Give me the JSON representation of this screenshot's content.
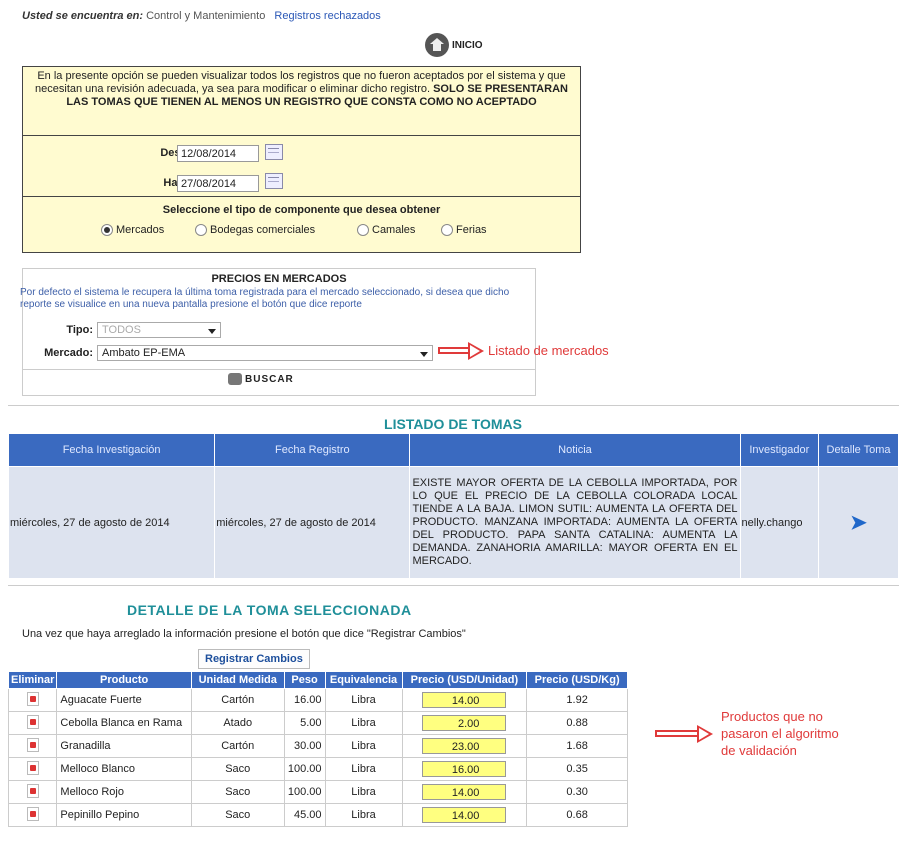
{
  "breadcrumb": {
    "label": "Usted se encuentra en:",
    "path": "Control y Mantenimiento",
    "current": "Registros rechazados"
  },
  "inicio_label": "INICIO",
  "filter": {
    "description_normal": "En la presente opción se pueden visualizar todos los registros que no fueron aceptados por el sistema y que necesitan una revisión adecuada, ya sea para modificar o eliminar dicho registro.",
    "description_bold": "SOLO SE PRESENTARAN LAS TOMAS QUE TIENEN AL MENOS UN REGISTRO QUE CONSTA COMO NO ACEPTADO",
    "desde_label": "Desde:",
    "desde_value": "12/08/2014",
    "hasta_label": "Hasta:",
    "hasta_value": "27/08/2014",
    "component_title": "Seleccione el tipo de componente que desea obtener",
    "components": [
      "Mercados",
      "Bodegas comerciales",
      "Camales",
      "Ferias"
    ]
  },
  "prices": {
    "title": "PRECIOS EN MERCADOS",
    "description": "Por defecto el sistema le recupera la última toma registrada para el mercado seleccionado, si desea que dicho reporte se visualice en una nueva pantalla presione el botón que dice reporte",
    "tipo_label": "Tipo:",
    "tipo_value": "TODOS",
    "mercado_label": "Mercado:",
    "mercado_value": "Ambato EP-EMA",
    "buscar_label": "BUSCAR"
  },
  "callout_mercados": "Listado de mercados",
  "listado": {
    "title": "LISTADO DE TOMAS",
    "headers": [
      "Fecha Investigación",
      "Fecha Registro",
      "Noticia",
      "Investigador",
      "Detalle Toma"
    ],
    "row": {
      "fecha_investigacion": "miércoles, 27 de agosto de 2014",
      "fecha_registro": "miércoles, 27 de agosto de 2014",
      "noticia": "EXISTE MAYOR OFERTA DE LA CEBOLLA IMPORTADA, POR LO QUE EL PRECIO DE LA CEBOLLA COLORADA LOCAL TIENDE A LA BAJA. LIMON SUTIL: AUMENTA LA OFERTA DEL PRODUCTO. MANZANA IMPORTADA: AUMENTA LA OFERTA DEL PRODUCTO. PAPA SANTA CATALINA: AUMENTA LA DEMANDA. ZANAHORIA AMARILLA: MAYOR OFERTA EN EL MERCADO.",
      "investigador": "nelly.chango"
    }
  },
  "detalle": {
    "title": "DETALLE DE LA TOMA SELECCIONADA",
    "description": "Una vez que haya arreglado la información presione el botón que dice \"Registrar Cambios\"",
    "registrar_label": "Registrar Cambios",
    "headers": [
      "Eliminar",
      "Producto",
      "Unidad Medida",
      "Peso",
      "Equivalencia",
      "Precio (USD/Unidad)",
      "Precio (USD/Kg)"
    ],
    "rows": [
      {
        "producto": "Aguacate Fuerte",
        "unidad": "Cartón",
        "peso": "16.00",
        "equivalencia": "Libra",
        "precio_unidad": "14.00",
        "precio_kg": "1.92"
      },
      {
        "producto": "Cebolla Blanca en Rama",
        "unidad": "Atado",
        "peso": "5.00",
        "equivalencia": "Libra",
        "precio_unidad": "2.00",
        "precio_kg": "0.88"
      },
      {
        "producto": "Granadilla",
        "unidad": "Cartón",
        "peso": "30.00",
        "equivalencia": "Libra",
        "precio_unidad": "23.00",
        "precio_kg": "1.68"
      },
      {
        "producto": "Melloco Blanco",
        "unidad": "Saco",
        "peso": "100.00",
        "equivalencia": "Libra",
        "precio_unidad": "16.00",
        "precio_kg": "0.35"
      },
      {
        "producto": "Melloco Rojo",
        "unidad": "Saco",
        "peso": "100.00",
        "equivalencia": "Libra",
        "precio_unidad": "14.00",
        "precio_kg": "0.30"
      },
      {
        "producto": "Pepinillo Pepino",
        "unidad": "Saco",
        "peso": "45.00",
        "equivalencia": "Libra",
        "precio_unidad": "14.00",
        "precio_kg": "0.68"
      }
    ]
  },
  "callout_productos": [
    "Productos que no",
    "pasaron el algoritmo",
    "de validación"
  ]
}
